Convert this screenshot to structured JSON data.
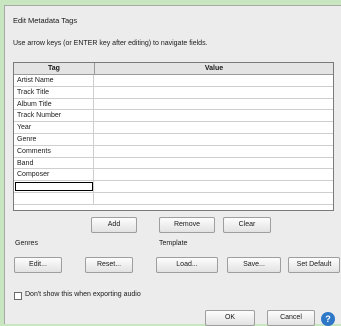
{
  "dialog": {
    "title": "Edit Metadata Tags",
    "hint": "Use arrow keys (or ENTER key after editing) to navigate fields."
  },
  "grid": {
    "headers": {
      "tag": "Tag",
      "value": "Value"
    },
    "rows": [
      {
        "tag": "Artist Name",
        "value": ""
      },
      {
        "tag": "Track Title",
        "value": ""
      },
      {
        "tag": "Album Title",
        "value": ""
      },
      {
        "tag": "Track Number",
        "value": ""
      },
      {
        "tag": "Year",
        "value": ""
      },
      {
        "tag": "Genre",
        "value": ""
      },
      {
        "tag": "Comments",
        "value": ""
      },
      {
        "tag": "Band",
        "value": ""
      },
      {
        "tag": "Composer",
        "value": ""
      },
      {
        "tag": "",
        "value": ""
      },
      {
        "tag": "",
        "value": ""
      }
    ]
  },
  "buttons": {
    "add": "Add",
    "remove": "Remove",
    "clear": "Clear",
    "edit": "Edit...",
    "reset": "Reset...",
    "load": "Load...",
    "save": "Save...",
    "set_default": "Set Default",
    "ok": "OK",
    "cancel": "Cancel"
  },
  "genres": {
    "label": "Genres"
  },
  "template": {
    "label": "Template"
  },
  "checkbox": {
    "label": "Don't show this when exporting audio",
    "checked": false
  },
  "help": {
    "glyph": "?"
  }
}
